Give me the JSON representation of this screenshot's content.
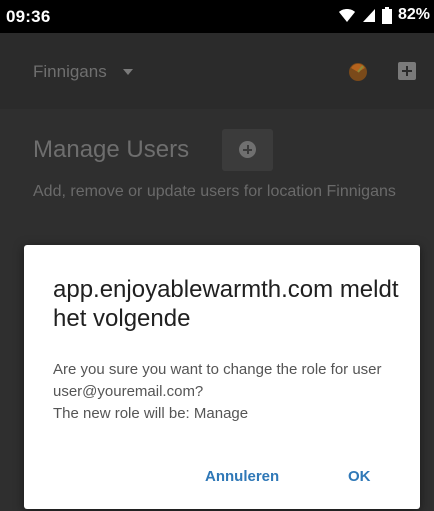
{
  "status_bar": {
    "time": "09:36",
    "battery": "82%"
  },
  "toolbar": {
    "location": "Finnigans"
  },
  "page": {
    "title": "Manage Users",
    "subtitle": "Add, remove or update users for location Finnigans"
  },
  "dialog": {
    "title": "app.enjoyablewarmth.com meldt het volgende",
    "message_line1": "Are you sure you want to change the role for user user@youremail.com?",
    "message_line2": "The new role will be: Manage",
    "cancel_label": "Annuleren",
    "ok_label": "OK"
  },
  "colors": {
    "accent": "#2f78b7",
    "overlay_bg": "#2f2f2f"
  }
}
